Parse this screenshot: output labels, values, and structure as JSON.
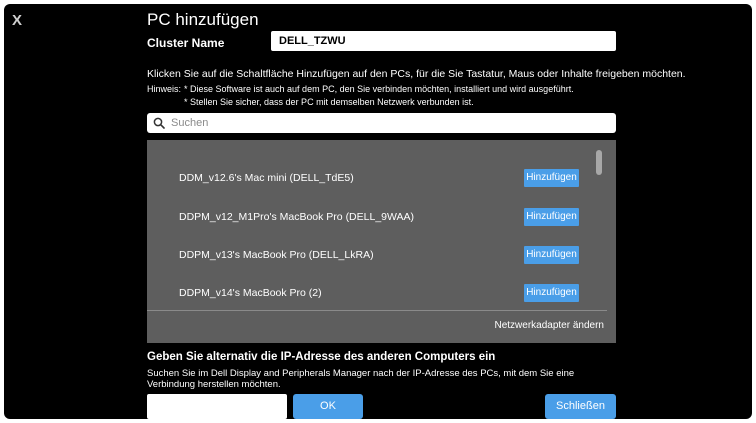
{
  "dialog": {
    "close_glyph": "X",
    "title": "PC hinzufügen"
  },
  "cluster": {
    "label": "Cluster Name",
    "value": "DELL_TZWU"
  },
  "instruction": "Klicken Sie auf die Schaltfläche Hinzufügen auf den PCs, für die Sie Tastatur, Maus oder Inhalte freigeben möchten.",
  "hint": {
    "label": "Hinweis:",
    "line1": "* Diese Software ist auch auf dem PC, den Sie verbinden möchten, installiert und wird ausgeführt.",
    "line2": "* Stellen Sie sicher, dass der PC mit demselben Netzwerk verbunden ist."
  },
  "search": {
    "icon": "search-icon",
    "placeholder": "Suchen"
  },
  "pc_list": [
    {
      "name": "DDM_v12.6's Mac mini (DELL_TdE5)",
      "button": "Hinzufügen"
    },
    {
      "name": "DDPM_v12_M1Pro's MacBook Pro (DELL_9WAA)",
      "button": "Hinzufügen"
    },
    {
      "name": "DDPM_v13's MacBook Pro (DELL_LkRA)",
      "button": "Hinzufügen"
    },
    {
      "name": "DDPM_v14's MacBook Pro (2)",
      "button": "Hinzufügen"
    }
  ],
  "adapter_link": "Netzwerkadapter ändern",
  "alternative": {
    "heading": "Geben Sie alternativ die IP-Adresse des anderen Computers ein",
    "description": "Suchen Sie im Dell Display and Peripherals Manager nach der IP-Adresse des PCs, mit dem Sie eine Verbindung herstellen möchten.",
    "ip_value": "",
    "ok_label": "OK"
  },
  "close_label": "Schließen",
  "colors": {
    "accent": "#4a9ee8",
    "dialog_bg": "#000000",
    "list_bg": "#5e5e5e"
  }
}
